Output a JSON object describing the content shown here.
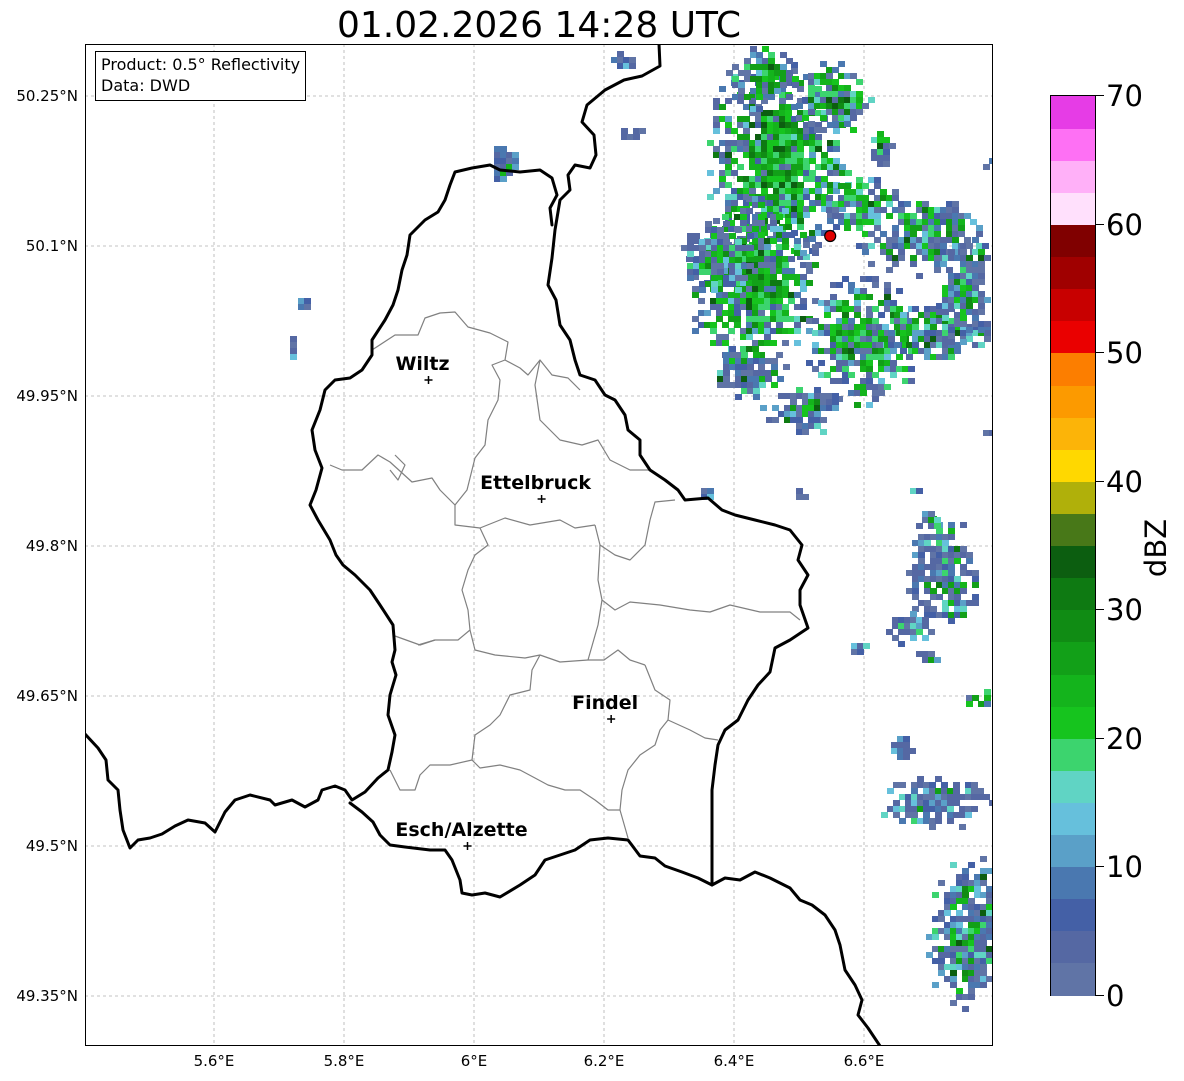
{
  "title": "01.02.2026 14:28 UTC",
  "info": {
    "product": "Product: 0.5° Reflectivity",
    "data": "Data: DWD"
  },
  "lat_ticks": [
    "50.25°N",
    "50.1°N",
    "49.95°N",
    "49.8°N",
    "49.65°N",
    "49.5°N",
    "49.35°N"
  ],
  "lon_ticks": [
    "5.6°E",
    "5.8°E",
    "6°E",
    "6.2°E",
    "6.4°E",
    "6.6°E"
  ],
  "colorbar": {
    "label": "dBZ",
    "ticks": [
      "0",
      "10",
      "20",
      "30",
      "40",
      "50",
      "60",
      "70"
    ],
    "colors": [
      "#6074a6",
      "#5568a3",
      "#4460a6",
      "#4a78b0",
      "#5aa0c8",
      "#66c0dc",
      "#60d4c4",
      "#3cd46e",
      "#16c41e",
      "#14b41c",
      "#12a018",
      "#108c14",
      "#0e7a12",
      "#0c5e10",
      "#487818",
      "#b0b00a",
      "#ffd800",
      "#fcb408",
      "#fc9a00",
      "#fc7e00",
      "#ea0000",
      "#c80000",
      "#a00000",
      "#800000",
      "#ffe0fc",
      "#ffb0f8",
      "#fe70f4",
      "#e63ce6"
    ]
  },
  "cities": [
    {
      "name": "Wiltz",
      "lon": 5.93,
      "lat": 49.966
    },
    {
      "name": "Ettelbruck",
      "lon": 6.104,
      "lat": 49.847
    },
    {
      "name": "Findel",
      "lon": 6.211,
      "lat": 49.627
    },
    {
      "name": "Esch/Alzette",
      "lon": 5.99,
      "lat": 49.5
    }
  ],
  "radar_site": {
    "lon": 6.548,
    "lat": 50.11,
    "color": "#e00000"
  }
}
